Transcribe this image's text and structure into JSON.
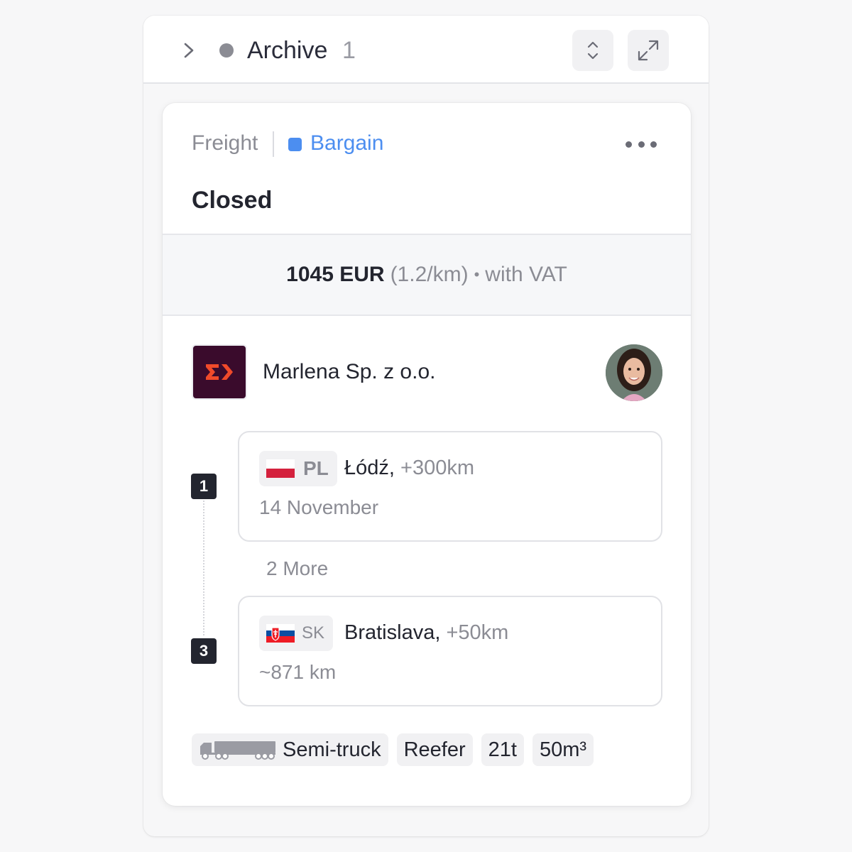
{
  "header": {
    "title": "Archive",
    "count": "1",
    "status_dot_color": "#8b8c94",
    "icons": [
      "chevron-right-icon",
      "sort-icon",
      "expand-icon"
    ]
  },
  "card": {
    "type_label": "Freight",
    "bargain_label": "Bargain",
    "bargain_color": "#4c8ef0",
    "status": "Closed",
    "price": {
      "amount": "1045 EUR",
      "rate": "(1.2/km)",
      "separator": "•",
      "vat": "with VAT"
    },
    "company": {
      "name": "Marlena Sp. z o.o.",
      "logo_bg": "#3a0b2c",
      "logo_accent": "#f04a2a"
    },
    "stops": [
      {
        "index": "1",
        "country": "PL",
        "city": "Łódź,",
        "distance": "+300km",
        "meta": "14 November"
      },
      {
        "index": "3",
        "country": "SK",
        "city": "Bratislava,",
        "distance": "+50km",
        "meta": "~871 km"
      }
    ],
    "more_stops": "2 More",
    "tags": {
      "vehicle": "Semi-truck",
      "body": "Reefer",
      "weight": "21t",
      "volume": "50m³"
    }
  }
}
